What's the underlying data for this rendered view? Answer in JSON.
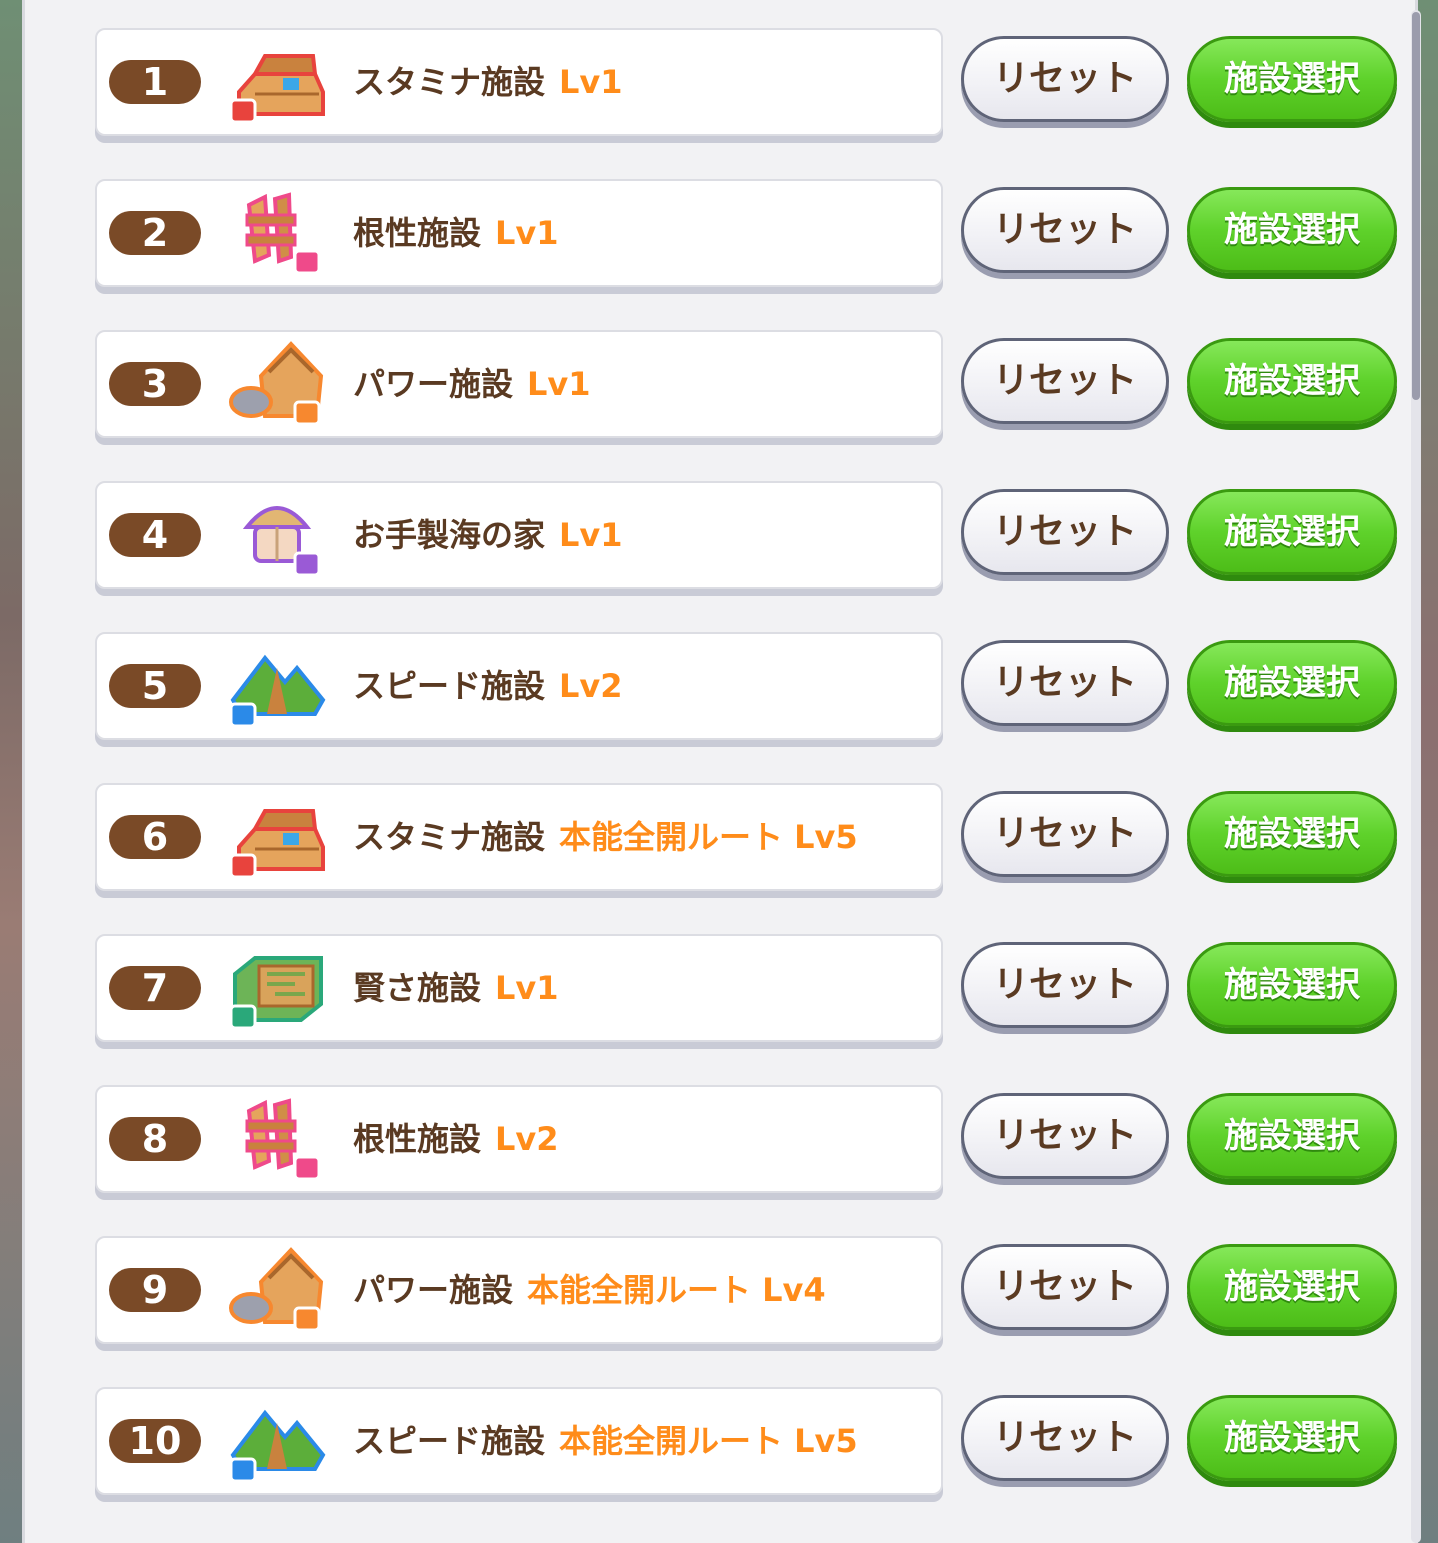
{
  "buttons": {
    "reset_label": "リセット",
    "select_label": "施設選択"
  },
  "items": [
    {
      "number": "1",
      "name": "スタミナ施設",
      "level": "Lv1",
      "icon": "stamina-facility-icon",
      "accent": "#e8433d"
    },
    {
      "number": "2",
      "name": "根性施設",
      "level": "Lv1",
      "icon": "guts-facility-icon",
      "accent": "#ef4a8a"
    },
    {
      "number": "3",
      "name": "パワー施設",
      "level": "Lv1",
      "icon": "power-facility-icon",
      "accent": "#f7882f"
    },
    {
      "number": "4",
      "name": "お手製海の家",
      "level": "Lv1",
      "icon": "beach-house-icon",
      "accent": "#9a5ad6"
    },
    {
      "number": "5",
      "name": "スピード施設",
      "level": "Lv2",
      "icon": "speed-facility-icon",
      "accent": "#2b8ae8"
    },
    {
      "number": "6",
      "name": "スタミナ施設",
      "level": "本能全開ルート Lv5",
      "icon": "stamina-facility-icon",
      "accent": "#e8433d"
    },
    {
      "number": "7",
      "name": "賢さ施設",
      "level": "Lv1",
      "icon": "wisdom-facility-icon",
      "accent": "#2aa87a"
    },
    {
      "number": "8",
      "name": "根性施設",
      "level": "Lv2",
      "icon": "guts-facility-icon",
      "accent": "#ef4a8a"
    },
    {
      "number": "9",
      "name": "パワー施設",
      "level": "本能全開ルート Lv4",
      "icon": "power-facility-icon",
      "accent": "#f7882f"
    },
    {
      "number": "10",
      "name": "スピード施設",
      "level": "本能全開ルート Lv5",
      "icon": "speed-facility-icon",
      "accent": "#2b8ae8"
    }
  ]
}
